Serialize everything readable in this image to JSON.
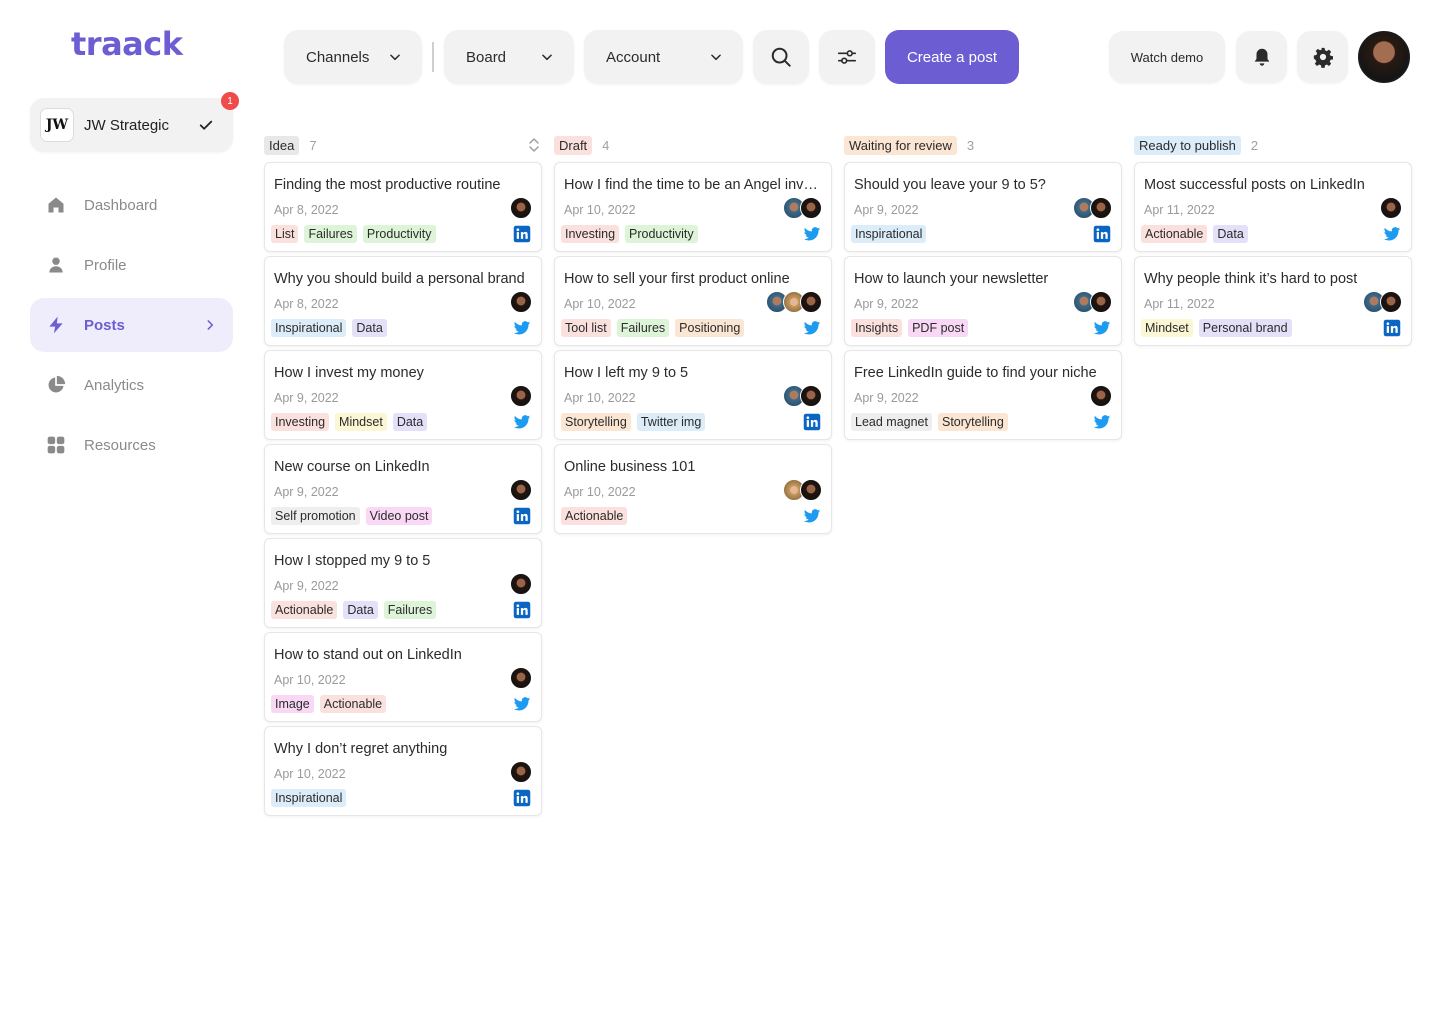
{
  "app": {
    "logo": "traack"
  },
  "workspace": {
    "logo_text": "JW",
    "name": "JW Strategic",
    "badge": "1"
  },
  "nav": [
    {
      "label": "Dashboard",
      "icon": "home-icon",
      "active": false
    },
    {
      "label": "Profile",
      "icon": "user-icon",
      "active": false
    },
    {
      "label": "Posts",
      "icon": "bolt-icon",
      "active": true
    },
    {
      "label": "Analytics",
      "icon": "pie-chart-icon",
      "active": false
    },
    {
      "label": "Resources",
      "icon": "grid-icon",
      "active": false
    }
  ],
  "toolbar": {
    "channels": "Channels",
    "view": "Board",
    "account": "Account",
    "create": "Create a post",
    "demo": "Watch demo"
  },
  "colors": {
    "accent": "#6c5dd3",
    "badge": "#ef4b4b",
    "linkedin": "#0a66c2",
    "twitter": "#1d9bf0"
  },
  "tag_colors": {
    "List": "t-red",
    "Failures": "t-green",
    "Productivity": "t-green",
    "Inspirational": "t-blue",
    "Data": "t-purple",
    "Investing": "t-red",
    "Mindset": "t-yellow",
    "Self promotion": "t-gray",
    "Video post": "t-pink",
    "Actionable": "t-red",
    "Image": "t-pink",
    "Tool list": "t-red",
    "Positioning": "t-orange",
    "Storytelling": "t-orange",
    "Twitter img": "t-blue",
    "Insights": "t-red",
    "PDF post": "t-pink",
    "Lead magnet": "t-gray",
    "Personal brand": "t-purple"
  },
  "columns": [
    {
      "status": "Idea",
      "status_color": "#e8e8e8",
      "count": "7",
      "cards": [
        {
          "title": "Finding the most productive routine",
          "date": "Apr 8, 2022",
          "tags": [
            "List",
            "Failures",
            "Productivity"
          ],
          "avatars": [
            "dark"
          ],
          "network": "linkedin"
        },
        {
          "title": "Why you should build a personal brand",
          "date": "Apr 8, 2022",
          "tags": [
            "Inspirational",
            "Data"
          ],
          "avatars": [
            "dark"
          ],
          "network": "twitter"
        },
        {
          "title": "How I invest my money",
          "date": "Apr 9, 2022",
          "tags": [
            "Investing",
            "Mindset",
            "Data"
          ],
          "avatars": [
            "dark"
          ],
          "network": "twitter"
        },
        {
          "title": "New course on LinkedIn",
          "date": "Apr 9, 2022",
          "tags": [
            "Self promotion",
            "Video post"
          ],
          "avatars": [
            "dark"
          ],
          "network": "linkedin"
        },
        {
          "title": "How I stopped my 9 to 5",
          "date": "Apr 9, 2022",
          "tags": [
            "Actionable",
            "Data",
            "Failures"
          ],
          "avatars": [
            "dark"
          ],
          "network": "linkedin"
        },
        {
          "title": "How to stand out on LinkedIn",
          "date": "Apr 10, 2022",
          "tags": [
            "Image",
            "Actionable"
          ],
          "avatars": [
            "dark"
          ],
          "network": "twitter"
        },
        {
          "title": "Why I don’t regret anything",
          "date": "Apr 10, 2022",
          "tags": [
            "Inspirational"
          ],
          "avatars": [
            "dark"
          ],
          "network": "linkedin"
        }
      ]
    },
    {
      "status": "Draft",
      "status_color": "#fbe1dd",
      "count": "4",
      "cards": [
        {
          "title": "How I find the time to be an Angel investor",
          "date": "Apr 10, 2022",
          "tags": [
            "Investing",
            "Productivity"
          ],
          "avatars": [
            "dark",
            "blue"
          ],
          "network": "twitter"
        },
        {
          "title": "How to sell your first product online",
          "date": "Apr 10, 2022",
          "tags": [
            "Tool list",
            "Failures",
            "Positioning"
          ],
          "avatars": [
            "dark",
            "blond",
            "blue"
          ],
          "network": "twitter"
        },
        {
          "title": "How I left my 9 to 5",
          "date": "Apr 10, 2022",
          "tags": [
            "Storytelling",
            "Twitter img"
          ],
          "avatars": [
            "dark",
            "blue"
          ],
          "network": "linkedin"
        },
        {
          "title": "Online business 101",
          "date": "Apr 10, 2022",
          "tags": [
            "Actionable"
          ],
          "avatars": [
            "dark",
            "blond"
          ],
          "network": "twitter"
        }
      ]
    },
    {
      "status": "Waiting for review",
      "status_color": "#fbe6d3",
      "count": "3",
      "cards": [
        {
          "title": "Should you leave your 9 to 5?",
          "date": "Apr 9, 2022",
          "tags": [
            "Inspirational"
          ],
          "avatars": [
            "dark",
            "blue"
          ],
          "network": "linkedin"
        },
        {
          "title": "How to launch your newsletter",
          "date": "Apr 9, 2022",
          "tags": [
            "Insights",
            "PDF post"
          ],
          "avatars": [
            "dark",
            "blue"
          ],
          "network": "twitter"
        },
        {
          "title": "Free LinkedIn guide to find your niche",
          "date": "Apr 9, 2022",
          "tags": [
            "Lead magnet",
            "Storytelling"
          ],
          "avatars": [
            "dark"
          ],
          "network": "twitter"
        }
      ]
    },
    {
      "status": "Ready to publish",
      "status_color": "#dcecf8",
      "count": "2",
      "cards": [
        {
          "title": "Most successful posts on LinkedIn",
          "date": "Apr 11, 2022",
          "tags": [
            "Actionable",
            "Data"
          ],
          "avatars": [
            "dark"
          ],
          "network": "twitter"
        },
        {
          "title": "Why people think it’s hard to post",
          "date": "Apr 11, 2022",
          "tags": [
            "Mindset",
            "Personal brand"
          ],
          "avatars": [
            "dark",
            "blue"
          ],
          "network": "linkedin"
        }
      ]
    }
  ]
}
